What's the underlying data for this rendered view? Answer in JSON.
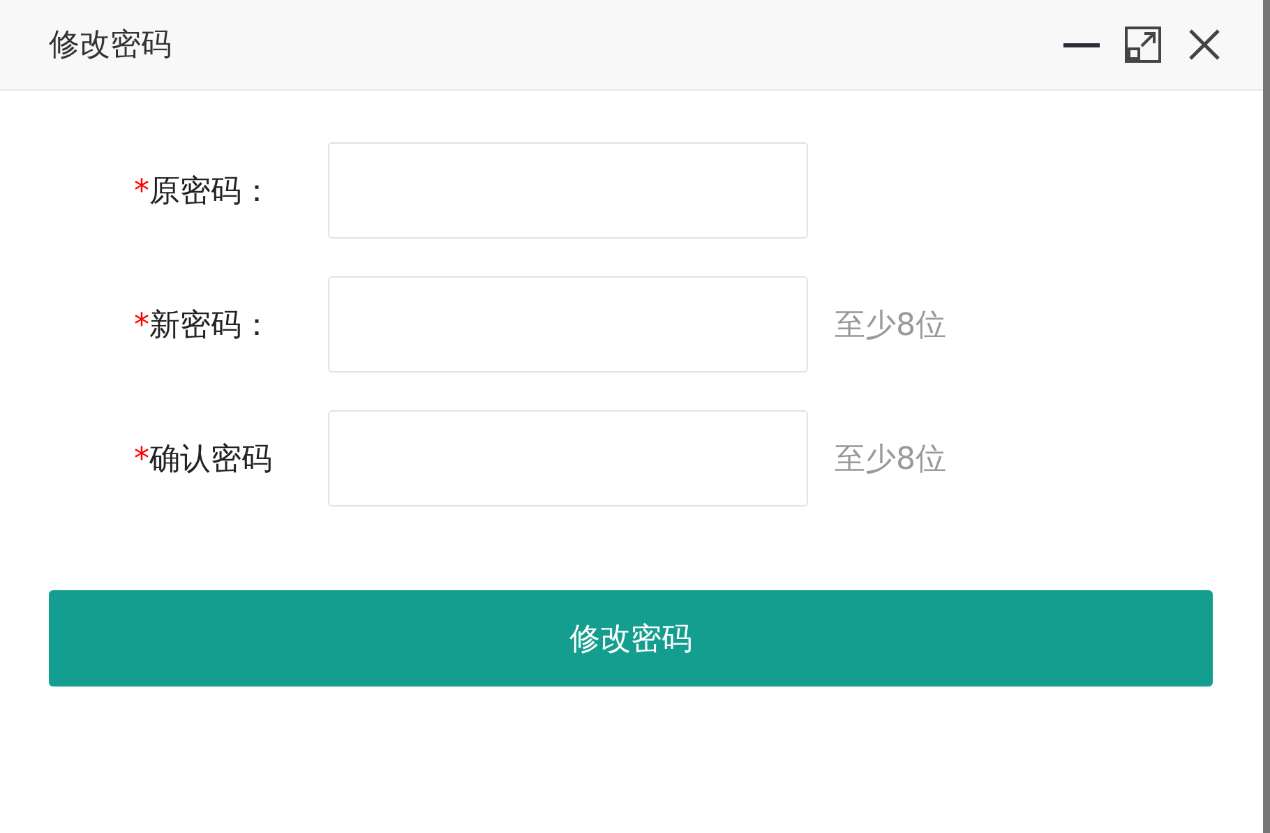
{
  "window": {
    "title": "修改密码"
  },
  "fields": [
    {
      "required_mark": "*",
      "label": "原密码："
    },
    {
      "required_mark": "*",
      "label": "新密码：",
      "hint": "至少8位"
    },
    {
      "required_mark": "*",
      "label": "确认密码",
      "hint": "至少8位"
    }
  ],
  "submit_button": {
    "label": "修改密码"
  }
}
